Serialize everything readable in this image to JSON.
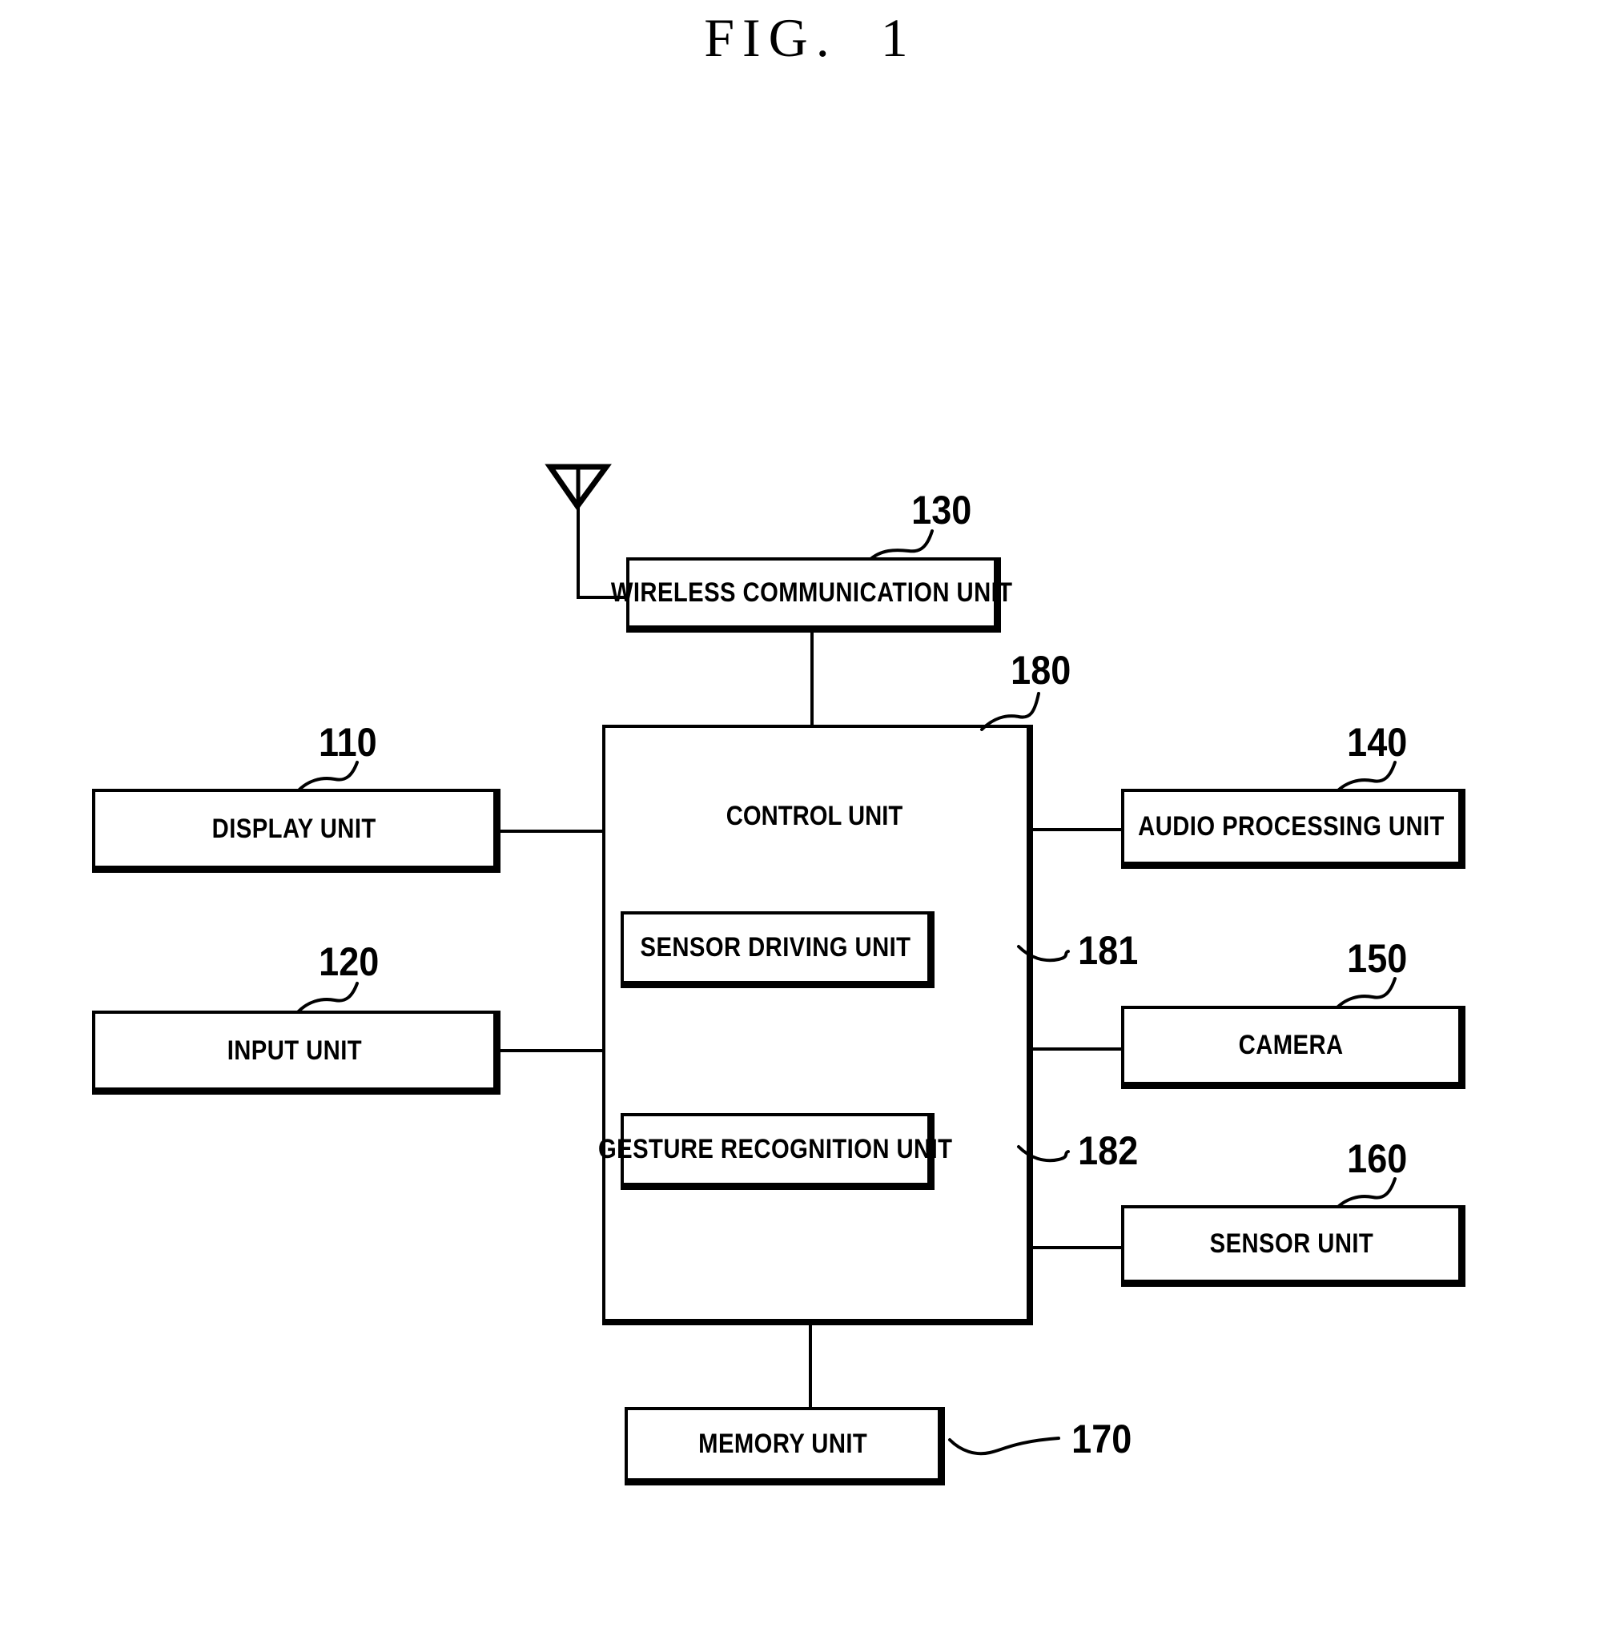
{
  "figure": {
    "title": "FIG.  1",
    "type": "block-diagram",
    "description": "Block diagram of a mobile terminal apparatus showing a control unit connected to peripheral units"
  },
  "blocks": {
    "wireless_communication_unit": {
      "label": "WIRELESS COMMUNICATION UNIT",
      "ref": "130"
    },
    "control_unit": {
      "label": "CONTROL UNIT",
      "ref": "180"
    },
    "display_unit": {
      "label": "DISPLAY UNIT",
      "ref": "110"
    },
    "input_unit": {
      "label": "INPUT UNIT",
      "ref": "120"
    },
    "audio_processing_unit": {
      "label": "AUDIO PROCESSING UNIT",
      "ref": "140"
    },
    "camera": {
      "label": "CAMERA",
      "ref": "150"
    },
    "sensor_unit": {
      "label": "SENSOR UNIT",
      "ref": "160"
    },
    "memory_unit": {
      "label": "MEMORY UNIT",
      "ref": "170"
    },
    "sensor_driving_unit": {
      "label": "SENSOR DRIVING UNIT",
      "ref": "181"
    },
    "gesture_recognition_unit": {
      "label": "GESTURE RECOGNITION UNIT",
      "ref": "182"
    }
  },
  "icons": {
    "antenna": "antenna-icon"
  },
  "colors": {
    "ink": "#000000",
    "paper": "#ffffff"
  }
}
